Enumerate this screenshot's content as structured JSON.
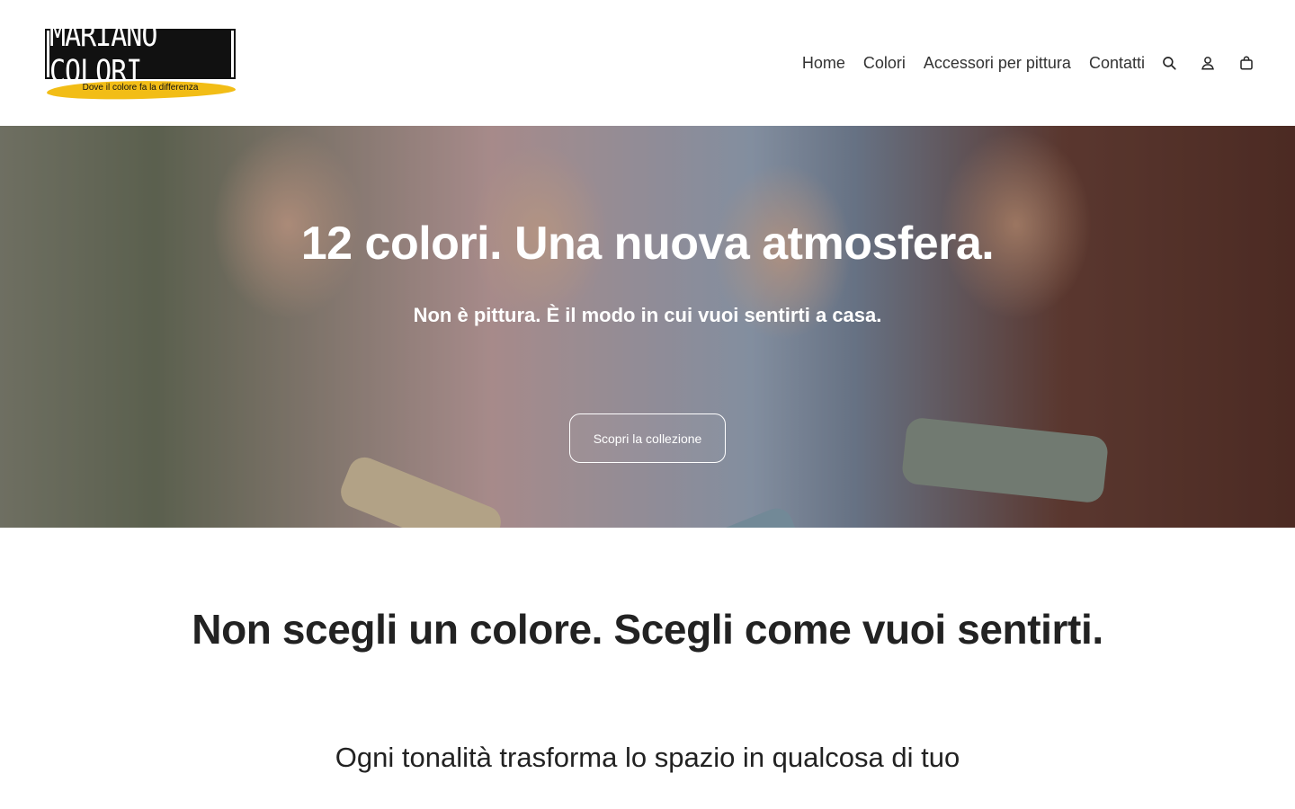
{
  "header": {
    "logo_text": "MARIANO COLORI",
    "logo_tagline": "Dove il colore fa la differenza",
    "nav": [
      {
        "label": "Home"
      },
      {
        "label": "Colori"
      },
      {
        "label": "Accessori per pittura"
      },
      {
        "label": "Contatti"
      }
    ],
    "icons": [
      "search-icon",
      "account-icon",
      "cart-icon"
    ]
  },
  "hero": {
    "title": "12 colori. Una nuova atmosfera.",
    "subtitle": "Non è pittura. È il modo in cui vuoi sentirti a casa.",
    "button_label": "Scopri la collezione"
  },
  "section": {
    "heading": "Non scegli un colore. Scegli come vuoi sentirti.",
    "subheading": "Ogni tonalità trasforma lo spazio in qualcosa di tuo"
  },
  "colors": {
    "brand_yellow": "#f2bd16",
    "text_dark": "#222222",
    "background": "#ffffff"
  }
}
